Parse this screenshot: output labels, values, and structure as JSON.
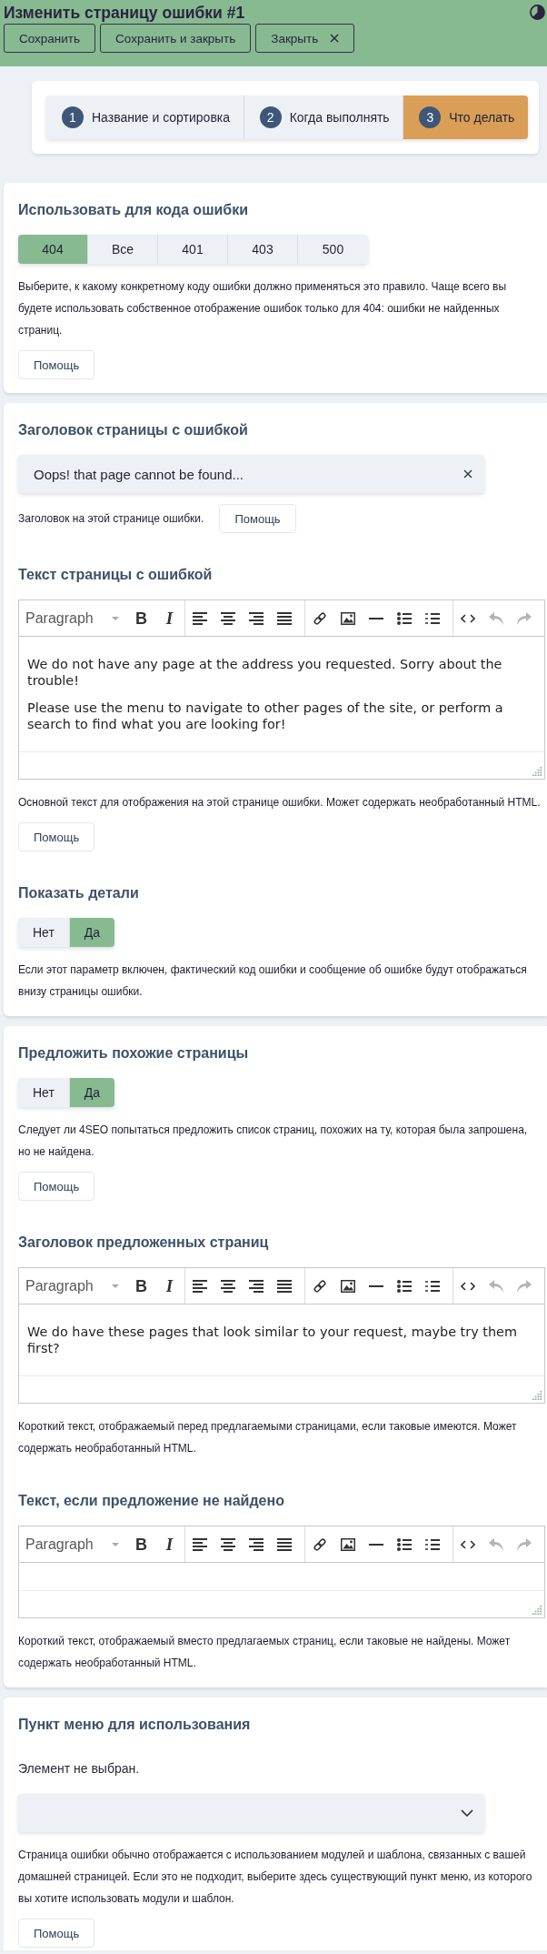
{
  "header": {
    "title": "Изменить страницу ошибки #1",
    "buttons": [
      {
        "kind": "save",
        "label": "Сохранить"
      },
      {
        "kind": "save-close",
        "label": "Сохранить и закрыть"
      },
      {
        "kind": "close",
        "label": "Закрыть"
      }
    ]
  },
  "steps": [
    {
      "number": "1",
      "label": "Название и сортировка",
      "selected": false
    },
    {
      "number": "2",
      "label": "Когда выполнять",
      "selected": false
    },
    {
      "number": "3",
      "label": "Что делать",
      "selected": true
    }
  ],
  "cards": [
    {
      "fields": [
        {
          "kind": "choice",
          "title": "Использовать для кода ошибки",
          "options": [
            {
              "label": "404",
              "selected": true
            },
            {
              "label": "Все",
              "selected": false
            },
            {
              "label": "401",
              "selected": false
            },
            {
              "label": "403",
              "selected": false
            },
            {
              "label": "500",
              "selected": false
            }
          ],
          "description": "Выберите, к какому конкретному коду ошибки должно применяться это правило. Чаще всего вы будете использовать собственное отображение ошибок только для 404: ошибки не найденных страниц.",
          "help": "Помощь"
        }
      ]
    },
    {
      "fields": [
        {
          "kind": "text",
          "title": "Заголовок страницы с ошибкой",
          "value": "Oops! that page cannot be found...",
          "description": "Заголовок на этой странице ошибки.",
          "help": "Помощь"
        },
        {
          "kind": "editor",
          "title": "Текст страницы с ошибкой",
          "toolbar": [
            {
              "items": [
                {
                  "kind": "format",
                  "label": "Paragraph",
                  "disabled": false
                },
                {
                  "kind": "bold",
                  "label": "B",
                  "disabled": false
                },
                {
                  "kind": "italic",
                  "label": "I",
                  "disabled": false
                }
              ]
            },
            {
              "items": [
                {
                  "kind": "align-left",
                  "disabled": false
                },
                {
                  "kind": "align-center",
                  "disabled": false
                },
                {
                  "kind": "align-right",
                  "disabled": false
                },
                {
                  "kind": "justify",
                  "disabled": false
                }
              ]
            },
            {
              "items": [
                {
                  "kind": "link",
                  "disabled": false
                },
                {
                  "kind": "image",
                  "disabled": false
                },
                {
                  "kind": "hr",
                  "disabled": false
                },
                {
                  "kind": "bullet-list",
                  "disabled": false
                },
                {
                  "kind": "numbered-list",
                  "disabled": false
                }
              ]
            },
            {
              "items": [
                {
                  "kind": "code",
                  "disabled": false
                },
                {
                  "kind": "undo",
                  "disabled": true
                },
                {
                  "kind": "redo",
                  "disabled": true
                }
              ]
            }
          ],
          "paragraphs": [
            "We do not have any page at the address you requested. Sorry about the trouble!",
            "Please use the menu to navigate to other pages of the site, or perform a search to find what you are looking for!"
          ],
          "description": "Основной текст для отображения на этой странице ошибки. Может содержать необработанный HTML.",
          "help": "Помощь"
        },
        {
          "kind": "toggle",
          "title": "Показать детали",
          "options": [
            {
              "label": "Нет",
              "selected": false
            },
            {
              "label": "Да",
              "selected": true
            }
          ],
          "description": "Если этот параметр включен, фактический код ошибки и сообщение об ошибке будут отображаться внизу страницы ошибки."
        }
      ]
    },
    {
      "fields": [
        {
          "kind": "toggle",
          "title": "Предложить похожие страницы",
          "options": [
            {
              "label": "Нет",
              "selected": false
            },
            {
              "label": "Да",
              "selected": true
            }
          ],
          "description": "Следует ли 4SEO попытаться предложить список страниц, похожих на ту, которая была запрошена, но не найдена.",
          "help": "Помощь"
        },
        {
          "kind": "editor",
          "title": "Заголовок предложенных страниц",
          "toolbar": [
            {
              "items": [
                {
                  "kind": "format",
                  "label": "Paragraph",
                  "disabled": false
                },
                {
                  "kind": "bold",
                  "label": "B",
                  "disabled": false
                },
                {
                  "kind": "italic",
                  "label": "I",
                  "disabled": false
                }
              ]
            },
            {
              "items": [
                {
                  "kind": "align-left",
                  "disabled": false
                },
                {
                  "kind": "align-center",
                  "disabled": false
                },
                {
                  "kind": "align-right",
                  "disabled": false
                },
                {
                  "kind": "justify",
                  "disabled": false
                }
              ]
            },
            {
              "items": [
                {
                  "kind": "link",
                  "disabled": false
                },
                {
                  "kind": "image",
                  "disabled": false
                },
                {
                  "kind": "hr",
                  "disabled": false
                },
                {
                  "kind": "bullet-list",
                  "disabled": false
                },
                {
                  "kind": "numbered-list",
                  "disabled": false
                }
              ]
            },
            {
              "items": [
                {
                  "kind": "code",
                  "disabled": false
                },
                {
                  "kind": "undo",
                  "disabled": true
                },
                {
                  "kind": "redo",
                  "disabled": true
                }
              ]
            }
          ],
          "paragraphs": [
            "We do have these pages that look similar to your request, maybe try them first?"
          ],
          "description": "Короткий текст, отображаемый перед предлагаемыми страницами, если таковые имеются. Может содержать необработанный HTML."
        },
        {
          "kind": "editor",
          "title": "Текст, если предложение не найдено",
          "toolbar": [
            {
              "items": [
                {
                  "kind": "format",
                  "label": "Paragraph",
                  "disabled": false
                },
                {
                  "kind": "bold",
                  "label": "B",
                  "disabled": false
                },
                {
                  "kind": "italic",
                  "label": "I",
                  "disabled": false
                }
              ]
            },
            {
              "items": [
                {
                  "kind": "align-left",
                  "disabled": false
                },
                {
                  "kind": "align-center",
                  "disabled": false
                },
                {
                  "kind": "align-right",
                  "disabled": false
                },
                {
                  "kind": "justify",
                  "disabled": false
                }
              ]
            },
            {
              "items": [
                {
                  "kind": "link",
                  "disabled": false
                },
                {
                  "kind": "image",
                  "disabled": false
                },
                {
                  "kind": "hr",
                  "disabled": false
                },
                {
                  "kind": "bullet-list",
                  "disabled": false
                },
                {
                  "kind": "numbered-list",
                  "disabled": false
                }
              ]
            },
            {
              "items": [
                {
                  "kind": "code",
                  "disabled": false
                },
                {
                  "kind": "undo",
                  "disabled": true
                },
                {
                  "kind": "redo",
                  "disabled": true
                }
              ]
            }
          ],
          "description": "Короткий текст, отображаемый вместо предлагаемых страниц, если таковые не найдены. Может содержать необработанный HTML."
        }
      ]
    },
    {
      "fields": [
        {
          "kind": "menu-select",
          "title": "Пункт меню для использования",
          "note": "Элемент не выбран.",
          "description": "Страница ошибки обычно отображается с использованием модулей и шаблона, связанных с вашей домашней страницей. Если это не подходит, выберите здесь существующий пункт меню, из которого вы хотите использовать модули и шаблон.",
          "help": "Помощь"
        }
      ]
    }
  ]
}
